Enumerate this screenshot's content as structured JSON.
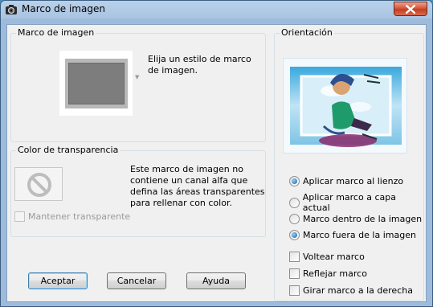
{
  "window": {
    "title": "Marco de imagen"
  },
  "frame_group": {
    "title": "Marco de imagen",
    "hint": "Elija un estilo de marco de imagen."
  },
  "transparency_group": {
    "title": "Color de transparencia",
    "note": "Este marco de imagen no contiene un canal alfa que defina las áreas transparentes para rellenar con color.",
    "keep_transparent": {
      "label": "Mantener transparente",
      "checked": false,
      "enabled": false
    }
  },
  "orientation_group": {
    "title": "Orientación",
    "apply_options": [
      {
        "label": "Aplicar marco al lienzo",
        "checked": true
      },
      {
        "label": "Aplicar marco a capa actual",
        "checked": false
      }
    ],
    "position_options": [
      {
        "label": "Marco dentro de la imagen",
        "checked": false
      },
      {
        "label": "Marco fuera de la imagen",
        "checked": true
      }
    ],
    "checkboxes": [
      {
        "label": "Voltear marco",
        "checked": false
      },
      {
        "label": "Reflejar marco",
        "checked": false
      },
      {
        "label": "Girar marco a la derecha",
        "checked": false
      }
    ]
  },
  "buttons": {
    "ok": "Aceptar",
    "cancel": "Cancelar",
    "help": "Ayuda"
  },
  "icons": {
    "app": "camera-icon",
    "close": "close-icon",
    "no_color": "prohibited-icon"
  },
  "colors": {
    "close_red": "#c33f22",
    "default_border": "#3c7fb1"
  }
}
